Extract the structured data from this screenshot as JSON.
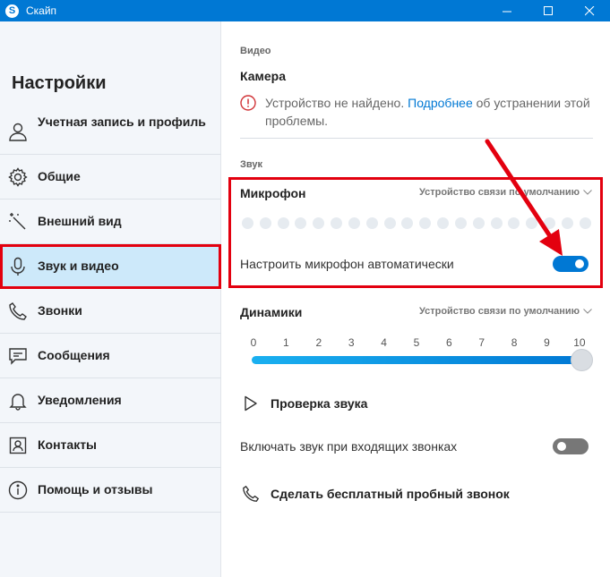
{
  "window": {
    "title": "Скайп",
    "app_icon": "skype-icon",
    "controls": [
      "minimize-icon",
      "maximize-icon",
      "close-icon"
    ]
  },
  "sidebar": {
    "title": "Настройки",
    "items": [
      {
        "label": "Учетная запись и профиль",
        "icon": "person-icon"
      },
      {
        "label": "Общие",
        "icon": "gear-icon"
      },
      {
        "label": "Внешний вид",
        "icon": "magic-wand-icon"
      },
      {
        "label": "Звук и видео",
        "icon": "microphone-icon",
        "active": true
      },
      {
        "label": "Звонки",
        "icon": "phone-icon"
      },
      {
        "label": "Сообщения",
        "icon": "message-icon"
      },
      {
        "label": "Уведомления",
        "icon": "bell-icon"
      },
      {
        "label": "Контакты",
        "icon": "contacts-icon"
      },
      {
        "label": "Помощь и отзывы",
        "icon": "info-icon"
      }
    ]
  },
  "video": {
    "section_label": "Видео",
    "camera_heading": "Камера",
    "warning_text": "Устройство не найдено. ",
    "warning_link": "Подробнее",
    "warning_text_after": " об устранении этой проблемы."
  },
  "sound": {
    "section_label": "Звук",
    "microphone": {
      "heading": "Микрофон",
      "device": "Устройство связи по умолчанию",
      "auto_label": "Настроить микрофон автоматически",
      "auto_enabled": true
    },
    "speakers": {
      "heading": "Динамики",
      "device": "Устройство связи по умолчанию",
      "ticks": [
        "0",
        "1",
        "2",
        "3",
        "4",
        "5",
        "6",
        "7",
        "8",
        "9",
        "10"
      ],
      "volume": 10
    },
    "test_audio": "Проверка звука",
    "ring_label": "Включать звук при входящих звонках",
    "ring_enabled": false,
    "test_call": "Сделать бесплатный пробный звонок"
  },
  "colors": {
    "accent": "#0078d4",
    "highlight": "#e3000f",
    "sidebar_bg": "#f3f6fa",
    "active_bg": "#cde9fa"
  }
}
